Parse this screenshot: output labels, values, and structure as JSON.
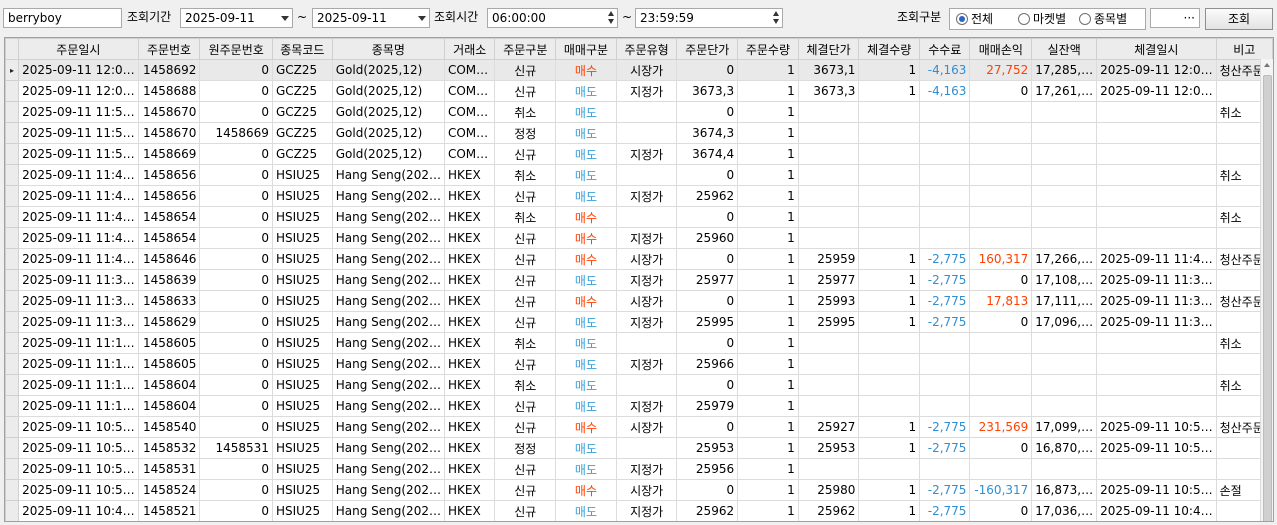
{
  "toolbar": {
    "account": "berryboy",
    "period_label": "조회기간",
    "date_from": "2025-09-11",
    "tilde": "~",
    "date_to": "2025-09-11",
    "time_label": "조회시간",
    "time_from": "06:00:00",
    "time_to": "23:59:59",
    "type_label": "조회구분",
    "radio_all": "전체",
    "radio_market": "마켓별",
    "radio_symbol": "종목별",
    "selected_radio": "전체",
    "more_label": "···",
    "search_button": "조회"
  },
  "colors": {
    "buy": "#ff4000",
    "sell": "#3aa0d8",
    "negative": "#2f8fd2",
    "positive": "#ff4000",
    "radio_selected": "#2a64c5"
  },
  "grid": {
    "columns": [
      "주문일시",
      "주문번호",
      "원주문번호",
      "종목코드",
      "종목명",
      "거래소",
      "주문구분",
      "매매구분",
      "주문유형",
      "주문단가",
      "주문수량",
      "체결단가",
      "체결수량",
      "수수료",
      "매매손익",
      "실잔액",
      "체결일시",
      "비고"
    ],
    "selected_row_marker": "▸",
    "rows": [
      [
        "2025-09-11 12:0…",
        "1458692",
        "0",
        "GCZ25",
        "Gold(2025,12)",
        "COM…",
        "신규",
        "매수",
        "시장가",
        "0",
        "1",
        "3673,1",
        "1",
        "-4,163",
        "27,752",
        "17,285,…",
        "2025-09-11 12:0…",
        "청산주문"
      ],
      [
        "2025-09-11 12:0…",
        "1458688",
        "0",
        "GCZ25",
        "Gold(2025,12)",
        "COM…",
        "신규",
        "매도",
        "지정가",
        "3673,3",
        "1",
        "3673,3",
        "1",
        "-4,163",
        "0",
        "17,261,…",
        "2025-09-11 12:0…",
        ""
      ],
      [
        "2025-09-11 11:5…",
        "1458670",
        "0",
        "GCZ25",
        "Gold(2025,12)",
        "COM…",
        "취소",
        "매도",
        "",
        "0",
        "1",
        "",
        "",
        "",
        "",
        "",
        "",
        "취소"
      ],
      [
        "2025-09-11 11:5…",
        "1458670",
        "1458669",
        "GCZ25",
        "Gold(2025,12)",
        "COM…",
        "정정",
        "매도",
        "",
        "3674,3",
        "1",
        "",
        "",
        "",
        "",
        "",
        "",
        ""
      ],
      [
        "2025-09-11 11:5…",
        "1458669",
        "0",
        "GCZ25",
        "Gold(2025,12)",
        "COM…",
        "신규",
        "매도",
        "지정가",
        "3674,4",
        "1",
        "",
        "",
        "",
        "",
        "",
        "",
        ""
      ],
      [
        "2025-09-11 11:4…",
        "1458656",
        "0",
        "HSIU25",
        "Hang Seng(202…",
        "HKEX",
        "취소",
        "매도",
        "",
        "0",
        "1",
        "",
        "",
        "",
        "",
        "",
        "",
        "취소"
      ],
      [
        "2025-09-11 11:4…",
        "1458656",
        "0",
        "HSIU25",
        "Hang Seng(202…",
        "HKEX",
        "신규",
        "매도",
        "지정가",
        "25962",
        "1",
        "",
        "",
        "",
        "",
        "",
        "",
        ""
      ],
      [
        "2025-09-11 11:4…",
        "1458654",
        "0",
        "HSIU25",
        "Hang Seng(202…",
        "HKEX",
        "취소",
        "매수",
        "",
        "0",
        "1",
        "",
        "",
        "",
        "",
        "",
        "",
        "취소"
      ],
      [
        "2025-09-11 11:4…",
        "1458654",
        "0",
        "HSIU25",
        "Hang Seng(202…",
        "HKEX",
        "신규",
        "매수",
        "지정가",
        "25960",
        "1",
        "",
        "",
        "",
        "",
        "",
        "",
        ""
      ],
      [
        "2025-09-11 11:4…",
        "1458646",
        "0",
        "HSIU25",
        "Hang Seng(202…",
        "HKEX",
        "신규",
        "매수",
        "시장가",
        "0",
        "1",
        "25959",
        "1",
        "-2,775",
        "160,317",
        "17,266,…",
        "2025-09-11 11:4…",
        "청산주문"
      ],
      [
        "2025-09-11 11:3…",
        "1458639",
        "0",
        "HSIU25",
        "Hang Seng(202…",
        "HKEX",
        "신규",
        "매도",
        "지정가",
        "25977",
        "1",
        "25977",
        "1",
        "-2,775",
        "0",
        "17,108,…",
        "2025-09-11 11:3…",
        ""
      ],
      [
        "2025-09-11 11:3…",
        "1458633",
        "0",
        "HSIU25",
        "Hang Seng(202…",
        "HKEX",
        "신규",
        "매수",
        "시장가",
        "0",
        "1",
        "25993",
        "1",
        "-2,775",
        "17,813",
        "17,111,…",
        "2025-09-11 11:3…",
        "청산주문"
      ],
      [
        "2025-09-11 11:3…",
        "1458629",
        "0",
        "HSIU25",
        "Hang Seng(202…",
        "HKEX",
        "신규",
        "매도",
        "지정가",
        "25995",
        "1",
        "25995",
        "1",
        "-2,775",
        "0",
        "17,096,…",
        "2025-09-11 11:3…",
        ""
      ],
      [
        "2025-09-11 11:1…",
        "1458605",
        "0",
        "HSIU25",
        "Hang Seng(202…",
        "HKEX",
        "취소",
        "매도",
        "",
        "0",
        "1",
        "",
        "",
        "",
        "",
        "",
        "",
        "취소"
      ],
      [
        "2025-09-11 11:1…",
        "1458605",
        "0",
        "HSIU25",
        "Hang Seng(202…",
        "HKEX",
        "신규",
        "매도",
        "지정가",
        "25966",
        "1",
        "",
        "",
        "",
        "",
        "",
        "",
        ""
      ],
      [
        "2025-09-11 11:1…",
        "1458604",
        "0",
        "HSIU25",
        "Hang Seng(202…",
        "HKEX",
        "취소",
        "매도",
        "",
        "0",
        "1",
        "",
        "",
        "",
        "",
        "",
        "",
        "취소"
      ],
      [
        "2025-09-11 11:1…",
        "1458604",
        "0",
        "HSIU25",
        "Hang Seng(202…",
        "HKEX",
        "신규",
        "매도",
        "지정가",
        "25979",
        "1",
        "",
        "",
        "",
        "",
        "",
        "",
        ""
      ],
      [
        "2025-09-11 10:5…",
        "1458540",
        "0",
        "HSIU25",
        "Hang Seng(202…",
        "HKEX",
        "신규",
        "매수",
        "시장가",
        "0",
        "1",
        "25927",
        "1",
        "-2,775",
        "231,569",
        "17,099,…",
        "2025-09-11 10:5…",
        "청산주문"
      ],
      [
        "2025-09-11 10:5…",
        "1458532",
        "1458531",
        "HSIU25",
        "Hang Seng(202…",
        "HKEX",
        "정정",
        "매도",
        "",
        "25953",
        "1",
        "25953",
        "1",
        "-2,775",
        "0",
        "16,870,…",
        "2025-09-11 10:5…",
        ""
      ],
      [
        "2025-09-11 10:5…",
        "1458531",
        "0",
        "HSIU25",
        "Hang Seng(202…",
        "HKEX",
        "신규",
        "매도",
        "지정가",
        "25956",
        "1",
        "",
        "",
        "",
        "",
        "",
        "",
        ""
      ],
      [
        "2025-09-11 10:5…",
        "1458524",
        "0",
        "HSIU25",
        "Hang Seng(202…",
        "HKEX",
        "신규",
        "매수",
        "시장가",
        "0",
        "1",
        "25980",
        "1",
        "-2,775",
        "-160,317",
        "16,873,…",
        "2025-09-11 10:5…",
        "손절"
      ],
      [
        "2025-09-11 10:4…",
        "1458521",
        "0",
        "HSIU25",
        "Hang Seng(202…",
        "HKEX",
        "신규",
        "매도",
        "지정가",
        "25962",
        "1",
        "25962",
        "1",
        "-2,775",
        "0",
        "17,036,…",
        "2025-09-11 10:4…",
        ""
      ]
    ]
  }
}
